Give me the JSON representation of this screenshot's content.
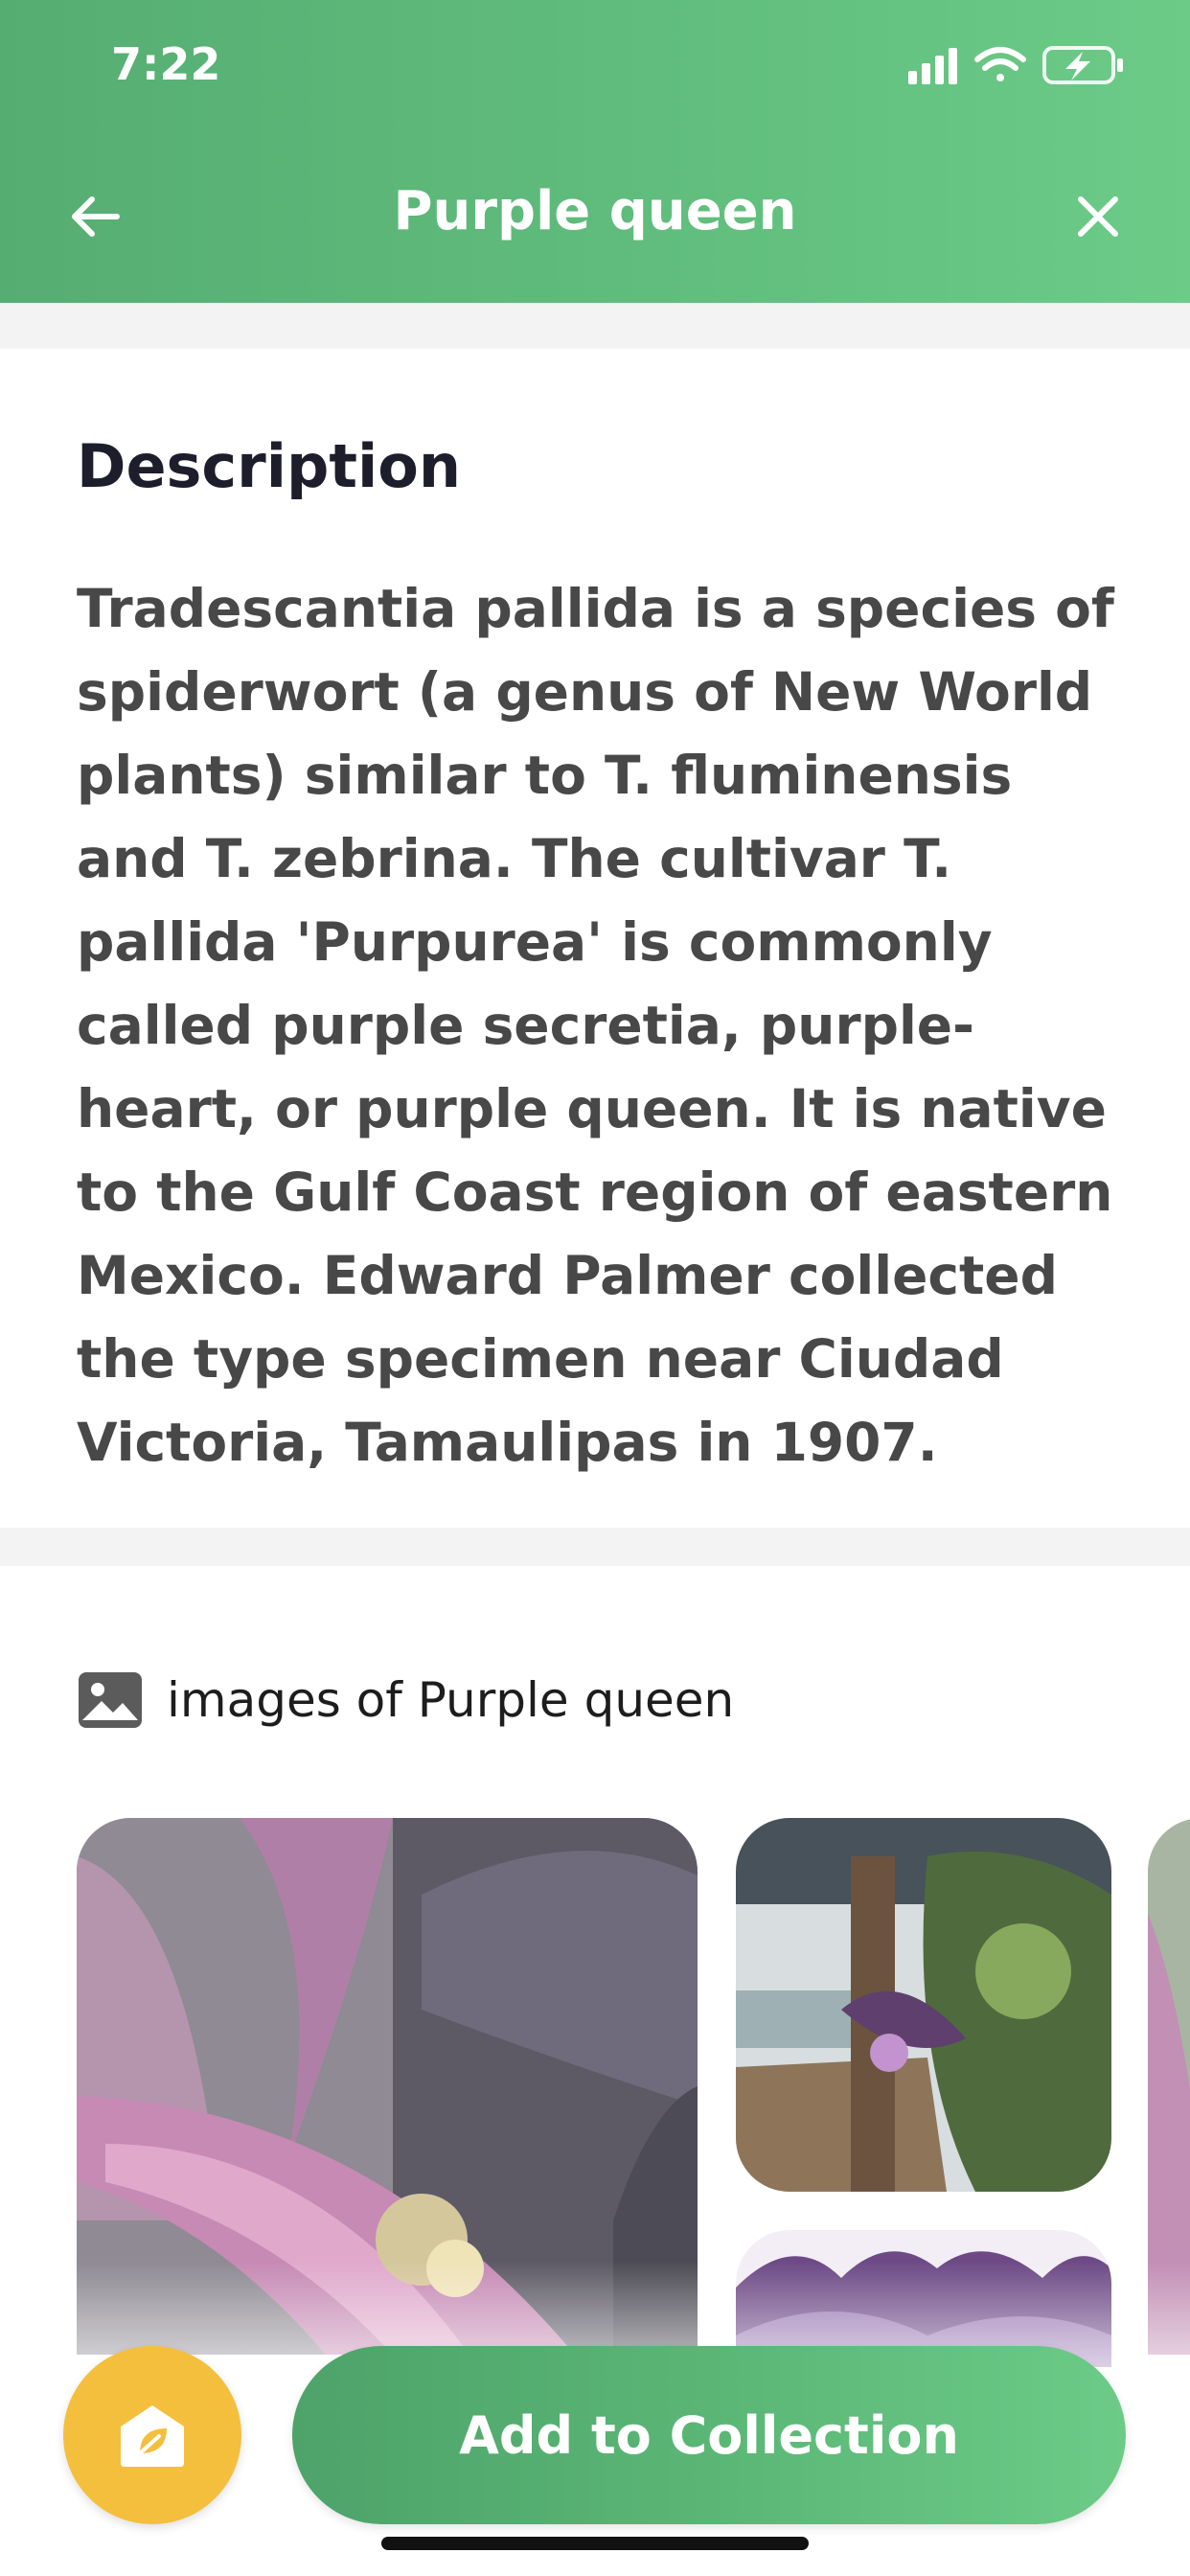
{
  "status_bar": {
    "time": "7:22"
  },
  "header": {
    "title": "Purple queen"
  },
  "description": {
    "heading": "Description",
    "text": "Tradescantia pallida is a species of spiderwort (a genus of New World plants) similar to T. fluminensis and T. zebrina. The cultivar T. pallida 'Purpurea' is commonly called purple secretia, purple-heart, or purple queen. It is native to the Gulf Coast region of eastern Mexico. Edward Palmer collected the type specimen near Ciudad Victoria, Tamaulipas in 1907."
  },
  "images": {
    "label_prefix": "images of",
    "plant_name": "Purple queen"
  },
  "actions": {
    "add_to_collection": "Add to Collection"
  },
  "icons": {
    "back": "arrow-left-icon",
    "close": "close-icon",
    "gallery": "image-icon",
    "collection": "plant-pot-icon"
  },
  "colors": {
    "header_start": "#56ad72",
    "header_end": "#6ccb87",
    "fab": "#f4bf3c",
    "button": "#5cb877"
  }
}
